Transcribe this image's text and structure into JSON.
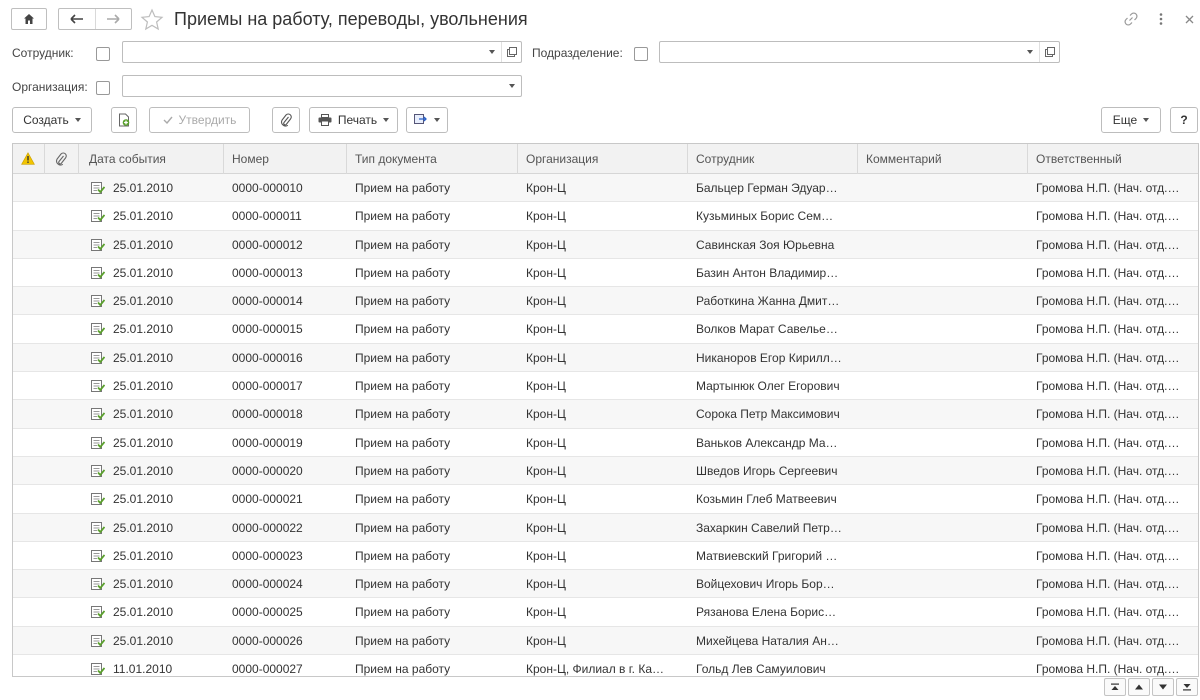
{
  "header": {
    "title": "Приемы на работу, переводы, увольнения"
  },
  "filters": {
    "employee_label": "Сотрудник:",
    "employee_value": "",
    "department_label": "Подразделение:",
    "department_value": "",
    "organization_label": "Организация:",
    "organization_value": ""
  },
  "toolbar": {
    "create_label": "Создать",
    "approve_label": "Утвердить",
    "print_label": "Печать",
    "more_label": "Еще",
    "help_label": "?"
  },
  "table": {
    "columns": [
      "Дата события",
      "Номер",
      "Тип документа",
      "Организация",
      "Сотрудник",
      "Комментарий",
      "Ответственный"
    ],
    "rows": [
      {
        "date": "25.01.2010",
        "number": "0000-000010",
        "type": "Прием на работу",
        "org": "Крон-Ц",
        "employee": "Бальцер Герман Эдуар…",
        "comment": "",
        "responsible": "Громова Н.П. (Нач. отд.…"
      },
      {
        "date": "25.01.2010",
        "number": "0000-000011",
        "type": "Прием на работу",
        "org": "Крон-Ц",
        "employee": "Кузьминых Борис Сем…",
        "comment": "",
        "responsible": "Громова Н.П. (Нач. отд.…"
      },
      {
        "date": "25.01.2010",
        "number": "0000-000012",
        "type": "Прием на работу",
        "org": "Крон-Ц",
        "employee": "Савинская Зоя Юрьевна",
        "comment": "",
        "responsible": "Громова Н.П. (Нач. отд.…"
      },
      {
        "date": "25.01.2010",
        "number": "0000-000013",
        "type": "Прием на работу",
        "org": "Крон-Ц",
        "employee": "Базин Антон Владимир…",
        "comment": "",
        "responsible": "Громова Н.П. (Нач. отд.…"
      },
      {
        "date": "25.01.2010",
        "number": "0000-000014",
        "type": "Прием на работу",
        "org": "Крон-Ц",
        "employee": "Работкина Жанна Дмит…",
        "comment": "",
        "responsible": "Громова Н.П. (Нач. отд.…"
      },
      {
        "date": "25.01.2010",
        "number": "0000-000015",
        "type": "Прием на работу",
        "org": "Крон-Ц",
        "employee": "Волков Марат Савелье…",
        "comment": "",
        "responsible": "Громова Н.П. (Нач. отд.…"
      },
      {
        "date": "25.01.2010",
        "number": "0000-000016",
        "type": "Прием на работу",
        "org": "Крон-Ц",
        "employee": "Никаноров Егор Кирилл…",
        "comment": "",
        "responsible": "Громова Н.П. (Нач. отд.…"
      },
      {
        "date": "25.01.2010",
        "number": "0000-000017",
        "type": "Прием на работу",
        "org": "Крон-Ц",
        "employee": "Мартынюк Олег Егорович",
        "comment": "",
        "responsible": "Громова Н.П. (Нач. отд.…"
      },
      {
        "date": "25.01.2010",
        "number": "0000-000018",
        "type": "Прием на работу",
        "org": "Крон-Ц",
        "employee": "Сорока Петр Максимович",
        "comment": "",
        "responsible": "Громова Н.П. (Нач. отд.…"
      },
      {
        "date": "25.01.2010",
        "number": "0000-000019",
        "type": "Прием на работу",
        "org": "Крон-Ц",
        "employee": "Ваньков Александр Ма…",
        "comment": "",
        "responsible": "Громова Н.П. (Нач. отд.…"
      },
      {
        "date": "25.01.2010",
        "number": "0000-000020",
        "type": "Прием на работу",
        "org": "Крон-Ц",
        "employee": "Шведов Игорь Сергеевич",
        "comment": "",
        "responsible": "Громова Н.П. (Нач. отд.…"
      },
      {
        "date": "25.01.2010",
        "number": "0000-000021",
        "type": "Прием на работу",
        "org": "Крон-Ц",
        "employee": "Козьмин Глеб Матвеевич",
        "comment": "",
        "responsible": "Громова Н.П. (Нач. отд.…"
      },
      {
        "date": "25.01.2010",
        "number": "0000-000022",
        "type": "Прием на работу",
        "org": "Крон-Ц",
        "employee": "Захаркин Савелий Петр…",
        "comment": "",
        "responsible": "Громова Н.П. (Нач. отд.…"
      },
      {
        "date": "25.01.2010",
        "number": "0000-000023",
        "type": "Прием на работу",
        "org": "Крон-Ц",
        "employee": "Матвиевский Григорий …",
        "comment": "",
        "responsible": "Громова Н.П. (Нач. отд.…"
      },
      {
        "date": "25.01.2010",
        "number": "0000-000024",
        "type": "Прием на работу",
        "org": "Крон-Ц",
        "employee": "Войцехович Игорь Бор…",
        "comment": "",
        "responsible": "Громова Н.П. (Нач. отд.…"
      },
      {
        "date": "25.01.2010",
        "number": "0000-000025",
        "type": "Прием на работу",
        "org": "Крон-Ц",
        "employee": "Рязанова Елена Борис…",
        "comment": "",
        "responsible": "Громова Н.П. (Нач. отд.…"
      },
      {
        "date": "25.01.2010",
        "number": "0000-000026",
        "type": "Прием на работу",
        "org": "Крон-Ц",
        "employee": "Михейцева Наталия Ан…",
        "comment": "",
        "responsible": "Громова Н.П. (Нач. отд.…"
      },
      {
        "date": "11.01.2010",
        "number": "0000-000027",
        "type": "Прием на работу",
        "org": "Крон-Ц, Филиал в г. Ка…",
        "employee": "Гольд Лев Самуилович",
        "comment": "",
        "responsible": "Громова Н.П. (Нач. отд.…"
      }
    ]
  },
  "icons": {
    "home": "home-icon",
    "back": "arrow-left-icon",
    "forward": "arrow-right-icon",
    "favorite": "star-icon",
    "link": "link-icon",
    "menu": "more-vertical-icon",
    "close": "close-icon",
    "warning": "warning-icon",
    "attachment": "paperclip-icon",
    "document": "document-posted-icon"
  },
  "colors": {
    "warning": "#f2c400",
    "doc_icon": "#5aa02c",
    "header_bg": "#f2f2f2",
    "border": "#bdbdbd"
  }
}
